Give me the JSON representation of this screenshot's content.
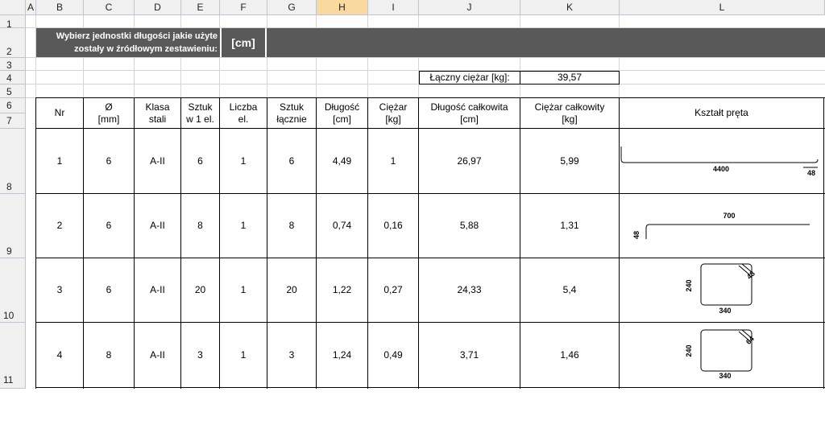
{
  "columns": [
    "",
    "A",
    "B",
    "C",
    "D",
    "E",
    "F",
    "G",
    "H",
    "I",
    "J",
    "K",
    "L"
  ],
  "rows": [
    "1",
    "2",
    "3",
    "4",
    "5",
    "6",
    "7",
    "8",
    "9",
    "10",
    "11"
  ],
  "banner": {
    "prompt_line1": "Wybierz jednostki długości jakie użyte",
    "prompt_line2": "zostały w źródłowym zestawieniu:",
    "unit": "[cm]"
  },
  "total": {
    "label": "Łączny ciężar [kg]:",
    "value": "39,57"
  },
  "table_header": {
    "nr": "Nr",
    "diam": "Ø",
    "diam_unit": "[mm]",
    "klasa1": "Klasa",
    "klasa2": "stali",
    "szt1": "Sztuk",
    "szt2": "w 1 el.",
    "liczba1": "Liczba",
    "liczba2": "el.",
    "sztl1": "Sztuk",
    "sztl2": "łącznie",
    "dl": "Długość",
    "dl_unit": "[cm]",
    "cz": "Ciężar",
    "cz_unit": "[kg]",
    "dlc": "Długość całkowita",
    "dlc_unit": "[cm]",
    "czc": "Ciężar całkowity",
    "czc_unit": "[kg]",
    "shape": "Kształt pręta"
  },
  "table_rows": [
    {
      "nr": "1",
      "d": "6",
      "klasa": "A-II",
      "szt": "6",
      "liczba": "1",
      "sztl": "6",
      "dl": "4,49",
      "cz": "1",
      "dlc": "26,97",
      "czc": "5,99"
    },
    {
      "nr": "2",
      "d": "6",
      "klasa": "A-II",
      "szt": "8",
      "liczba": "1",
      "sztl": "8",
      "dl": "0,74",
      "cz": "0,16",
      "dlc": "5,88",
      "czc": "1,31"
    },
    {
      "nr": "3",
      "d": "6",
      "klasa": "A-II",
      "szt": "20",
      "liczba": "1",
      "sztl": "20",
      "dl": "1,22",
      "cz": "0,27",
      "dlc": "24,33",
      "czc": "5,4"
    },
    {
      "nr": "4",
      "d": "8",
      "klasa": "A-II",
      "szt": "3",
      "liczba": "1",
      "sztl": "3",
      "dl": "1,24",
      "cz": "0,49",
      "dlc": "3,71",
      "czc": "1,46"
    }
  ],
  "shapes": {
    "s1_len": "4400",
    "s1_hook": "48",
    "s2_len": "700",
    "s2_hook": "48",
    "s3_h": "240",
    "s3_w": "340",
    "s3_hook": "48",
    "s4_h": "240",
    "s4_w": "340",
    "s4_hook": "64"
  },
  "colors": {
    "banner": "#595959",
    "header_selected": "#f9d99e",
    "header_bg": "#f0f0f0"
  }
}
